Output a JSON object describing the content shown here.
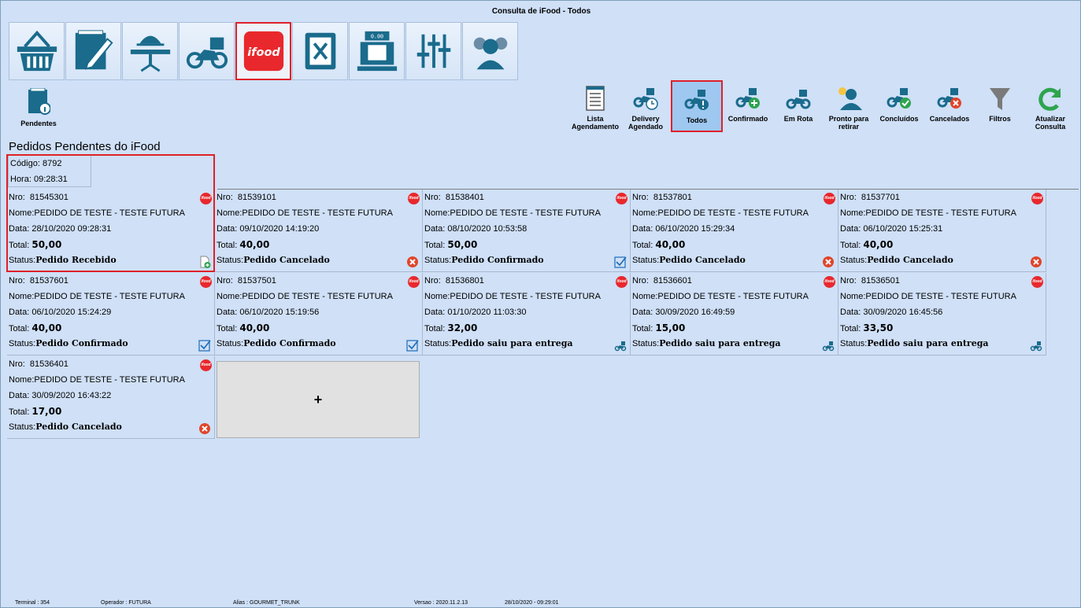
{
  "window": {
    "title": "Consulta de iFood - Todos"
  },
  "modules": [
    {
      "name": "basket-icon"
    },
    {
      "name": "notepad-icon"
    },
    {
      "name": "waiter-table-icon"
    },
    {
      "name": "motorcycle-icon"
    },
    {
      "name": "ifood-icon",
      "label": "ifood",
      "active": true
    },
    {
      "name": "menu-book-icon"
    },
    {
      "name": "cash-register-icon",
      "display": "0.00"
    },
    {
      "name": "sliders-icon"
    },
    {
      "name": "users-icon"
    }
  ],
  "pending_button": {
    "label": "Pendentes"
  },
  "toolbar": {
    "lista_agendamento": "Lista Agendamento",
    "delivery_agendado": "Delivery Agendado",
    "todos": "Todos",
    "confirmado": "Confirmado",
    "em_rota": "Em Rota",
    "pronto_retirar": "Pronto para retirar",
    "concluidos": "Concluídos",
    "cancelados": "Cancelados",
    "filtros": "Filtros",
    "atualizar": "Atualizar Consulta"
  },
  "heading": "Pedidos Pendentes do iFood",
  "info": {
    "codigo": "Código: 8792",
    "hora": "Hora: 09:28:31"
  },
  "labels": {
    "nro": "Nro:",
    "nome": "Nome:",
    "data": "Data:",
    "total": "Total:",
    "status": "Status:",
    "badge": "ifood"
  },
  "orders": [
    {
      "nro": "81545301",
      "nome": "PEDIDO DE TESTE - TESTE FUTURA",
      "data": "28/10/2020 09:28:31",
      "total": "50,00",
      "status": "Pedido Recebido",
      "icon": "new-document-icon"
    },
    {
      "nro": "81539101",
      "nome": "PEDIDO DE TESTE - TESTE FUTURA",
      "data": "09/10/2020 14:19:20",
      "total": "40,00",
      "status": "Pedido Cancelado",
      "icon": "cancel-icon"
    },
    {
      "nro": "81538401",
      "nome": "PEDIDO DE TESTE - TESTE FUTURA",
      "data": "08/10/2020 10:53:58",
      "total": "50,00",
      "status": "Pedido Confirmado",
      "icon": "check-icon"
    },
    {
      "nro": "81537801",
      "nome": "PEDIDO DE TESTE - TESTE FUTURA",
      "data": "06/10/2020 15:29:34",
      "total": "40,00",
      "status": "Pedido Cancelado",
      "icon": "cancel-icon"
    },
    {
      "nro": "81537701",
      "nome": "PEDIDO DE TESTE - TESTE FUTURA",
      "data": "06/10/2020 15:25:31",
      "total": "40,00",
      "status": "Pedido Cancelado",
      "icon": "cancel-icon"
    },
    {
      "nro": "81537601",
      "nome": "PEDIDO DE TESTE - TESTE FUTURA",
      "data": "06/10/2020 15:24:29",
      "total": "40,00",
      "status": "Pedido Confirmado",
      "icon": "check-icon"
    },
    {
      "nro": "81537501",
      "nome": "PEDIDO DE TESTE - TESTE FUTURA",
      "data": "06/10/2020 15:19:56",
      "total": "40,00",
      "status": "Pedido Confirmado",
      "icon": "check-icon"
    },
    {
      "nro": "81536801",
      "nome": "PEDIDO DE TESTE - TESTE FUTURA",
      "data": "01/10/2020 11:03:30",
      "total": "32,00",
      "status": "Pedido saiu para entrega",
      "icon": "motorcycle-icon"
    },
    {
      "nro": "81536601",
      "nome": "PEDIDO DE TESTE - TESTE FUTURA",
      "data": "30/09/2020 16:49:59",
      "total": "15,00",
      "status": "Pedido saiu para entrega",
      "icon": "motorcycle-icon"
    },
    {
      "nro": "81536501",
      "nome": "PEDIDO DE TESTE - TESTE FUTURA",
      "data": "30/09/2020 16:45:56",
      "total": "33,50",
      "status": "Pedido saiu para entrega",
      "icon": "motorcycle-icon"
    },
    {
      "nro": "81536401",
      "nome": "PEDIDO DE TESTE - TESTE FUTURA",
      "data": "30/09/2020 16:43:22",
      "total": "17,00",
      "status": "Pedido Cancelado",
      "icon": "cancel-icon"
    }
  ],
  "add_card": {
    "label": "+"
  },
  "statusbar": {
    "terminal": "Terminal : 354",
    "operador": "Operador : FUTURA",
    "alias": "Alias : GOURMET_TRUNK",
    "versao": "Versao : 2020.11.2.13",
    "datetime": "28/10/2020 - 09:29:01"
  },
  "colors": {
    "background": "#cfe0f7",
    "highlight": "#e0202a",
    "ifood_red": "#e8282c",
    "active_button": "#9ec8f0"
  }
}
